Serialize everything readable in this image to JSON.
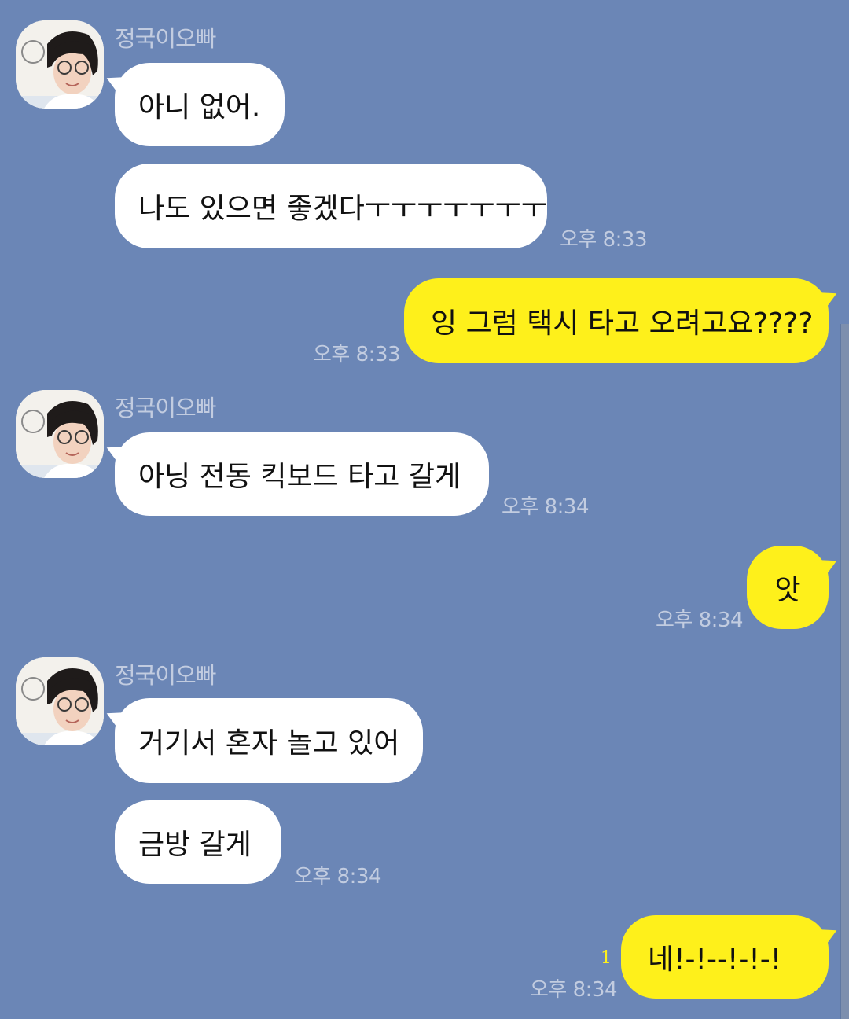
{
  "chat": {
    "sender_name": "정국이오빠",
    "colors": {
      "background": "#6b86b6",
      "incoming_bubble": "#ffffff",
      "outgoing_bubble": "#fef01b",
      "meta_text": "#c2cce0"
    },
    "messages": [
      {
        "direction": "in",
        "text": "아니 없어."
      },
      {
        "direction": "in",
        "text": "나도 있으면 좋겠다ㅜㅜㅜㅜㅜㅜㅜ",
        "time": "오후 8:33"
      },
      {
        "direction": "out",
        "text": "잉 그럼 택시 타고 오려고요????",
        "time": "오후 8:33"
      },
      {
        "direction": "in",
        "text": "아닝 전동 킥보드 타고 갈게",
        "time": "오후 8:34"
      },
      {
        "direction": "out",
        "text": "앗",
        "time": "오후 8:34"
      },
      {
        "direction": "in",
        "text": "거기서 혼자 놀고 있어"
      },
      {
        "direction": "in",
        "text": "금방 갈게",
        "time": "오후 8:34"
      },
      {
        "direction": "out",
        "text": "네!-!--!-!-!",
        "time": "오후 8:34",
        "unread": "1"
      }
    ]
  }
}
